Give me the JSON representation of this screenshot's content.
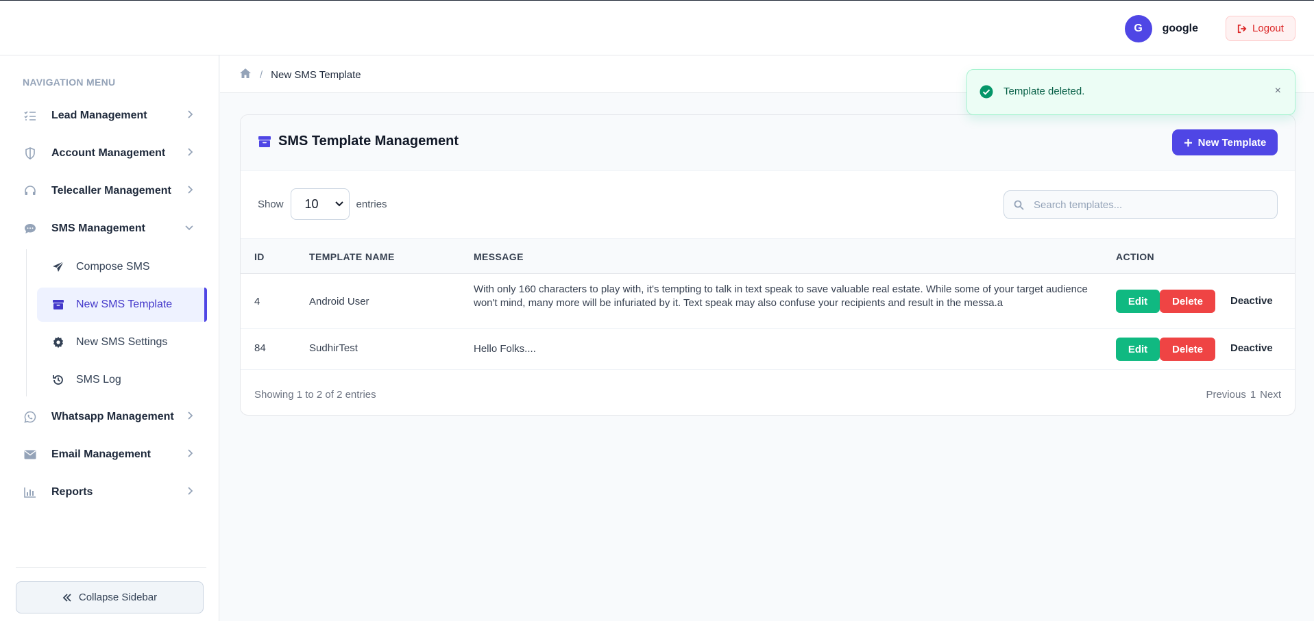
{
  "header": {
    "avatar_initial": "G",
    "username": "google",
    "logout_label": "Logout"
  },
  "sidebar": {
    "nav_title": "NAVIGATION MENU",
    "items": [
      {
        "label": "Lead Management",
        "icon": "list-check-icon"
      },
      {
        "label": "Account Management",
        "icon": "shield-icon"
      },
      {
        "label": "Telecaller Management",
        "icon": "headset-icon"
      },
      {
        "label": "SMS Management",
        "icon": "chat-bubble-icon",
        "expanded": true
      },
      {
        "label": "Whatsapp Management",
        "icon": "whatsapp-icon"
      },
      {
        "label": "Email Management",
        "icon": "envelope-icon"
      },
      {
        "label": "Reports",
        "icon": "bar-chart-icon"
      }
    ],
    "sms_sub_items": [
      {
        "label": "Compose SMS",
        "icon": "paper-plane-icon"
      },
      {
        "label": "New SMS Template",
        "icon": "archive-box-icon",
        "active": true
      },
      {
        "label": "New SMS Settings",
        "icon": "gear-icon"
      },
      {
        "label": "SMS Log",
        "icon": "history-icon"
      }
    ],
    "collapse_label": "Collapse Sidebar"
  },
  "breadcrumb": {
    "current": "New SMS Template"
  },
  "card": {
    "title": "SMS Template Management",
    "new_button_label": "New Template",
    "show_label": "Show",
    "entries_value": "10",
    "entries_label": "entries",
    "search_placeholder": "Search templates...",
    "columns": [
      "ID",
      "TEMPLATE NAME",
      "MESSAGE",
      "ACTION"
    ],
    "rows": [
      {
        "id": "4",
        "name": "Android User",
        "message": "With only 160 characters to play with, it's tempting to talk in text speak to save valuable real estate. While some of your target audience won't mind, many more will be infuriated by it. Text speak may also confuse your recipients and result in the messa.a",
        "edit_label": "Edit",
        "delete_label": "Delete",
        "status_action": "Deactive"
      },
      {
        "id": "84",
        "name": "SudhirTest",
        "message": "Hello Folks....",
        "edit_label": "Edit",
        "delete_label": "Delete",
        "status_action": "Deactive"
      }
    ],
    "footer_info": "Showing 1 to 2 of 2 entries",
    "pager": {
      "previous": "Previous",
      "page": "1",
      "next": "Next"
    }
  },
  "toast": {
    "message": "Template deleted.",
    "close_glyph": "×"
  },
  "colors": {
    "primary": "#4f46e5",
    "success": "#10b981",
    "danger": "#ef4444"
  }
}
